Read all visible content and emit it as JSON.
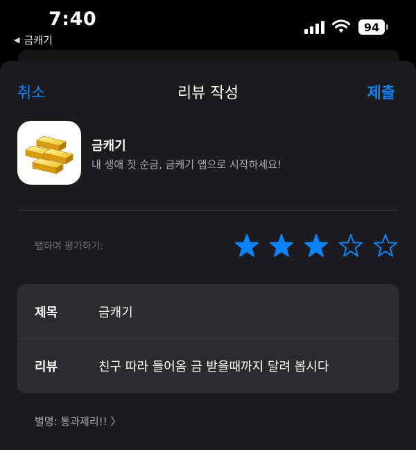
{
  "status": {
    "time": "7:40",
    "back_app": "금캐기",
    "battery": "94"
  },
  "nav": {
    "cancel": "취소",
    "title": "리뷰 작성",
    "submit": "제출"
  },
  "app": {
    "name": "금캐기",
    "subtitle": "내 생애 첫 순금, 금캐기 앱으로 시작하세요!",
    "icon": "gold-bars-icon"
  },
  "rating": {
    "label": "탭하여 평가하기:",
    "value": 3,
    "max": 5,
    "color": "#0a84ff"
  },
  "form": {
    "title_label": "제목",
    "title_value": "금캐기",
    "review_label": "리뷰",
    "review_value": "친구 따라 들어옴 금 받을때까지 달려 봅시다"
  },
  "nickname": "별명: 통과제리!! 〉",
  "colors": {
    "accent": "#0a84ff",
    "sheet": "#1c1c1e",
    "card": "#2c2c2e"
  }
}
